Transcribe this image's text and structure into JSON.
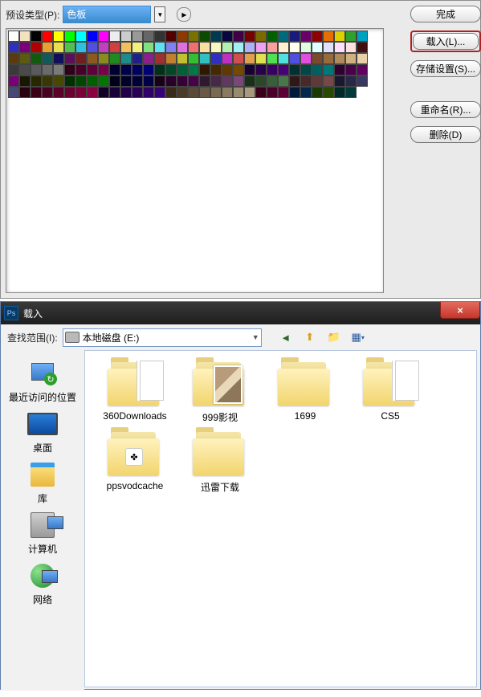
{
  "presetManager": {
    "typeLabel": "预设类型(P):",
    "typeValue": "色板",
    "buttons": {
      "done": "完成",
      "load": "载入(L)...",
      "save": "存储设置(S)...",
      "rename": "重命名(R)...",
      "delete": "删除(D)"
    },
    "swatches": [
      "#ffffff",
      "#f2e2c0",
      "#000000",
      "#ff0000",
      "#ffff00",
      "#00ff00",
      "#00ffff",
      "#0000ff",
      "#ff00ff",
      "#ededed",
      "#cccccc",
      "#999999",
      "#666666",
      "#333333",
      "#510000",
      "#8d3a00",
      "#7a7200",
      "#0c4a00",
      "#003a4e",
      "#08083e",
      "#3f0047",
      "#770000",
      "#7a6a00",
      "#006000",
      "#006a7a",
      "#1a1a7a",
      "#6a006a",
      "#8f0000",
      "#e96e00",
      "#dcd000",
      "#2fa02f",
      "#00a0c0",
      "#3030c0",
      "#7a007a",
      "#b00000",
      "#e8a030",
      "#e8e050",
      "#50c050",
      "#30c0e0",
      "#5050e0",
      "#c040c0",
      "#d04040",
      "#f0c060",
      "#f0f080",
      "#80e080",
      "#60e0f0",
      "#8080f0",
      "#e070e0",
      "#f07070",
      "#f8e0a0",
      "#f8f8c0",
      "#b0f0b0",
      "#a0f0f8",
      "#b0b0f8",
      "#f0a0f0",
      "#f8a0a0",
      "#fff0d0",
      "#fffff0",
      "#e0ffe0",
      "#e0ffff",
      "#e0e0ff",
      "#ffe0ff",
      "#ffe0e0",
      "#401010",
      "#5a3a10",
      "#5a5a10",
      "#105a10",
      "#105a5a",
      "#10105a",
      "#5a105a",
      "#702020",
      "#8a5a20",
      "#8a8a20",
      "#208a20",
      "#208a8a",
      "#20208a",
      "#8a208a",
      "#a03030",
      "#c08030",
      "#c0c030",
      "#30c030",
      "#30c0c0",
      "#3030c0",
      "#c030c0",
      "#d05050",
      "#e0a050",
      "#e0e050",
      "#50e050",
      "#50e0e0",
      "#5050e0",
      "#e050e0",
      "#7a4a2a",
      "#9a6a3a",
      "#b08a5a",
      "#d0b080",
      "#e8d0a8",
      "#3a3a3a",
      "#4a4a4a",
      "#5a5a5a",
      "#6a6a6a",
      "#7a7a7a",
      "#300018",
      "#480028",
      "#600038",
      "#780048",
      "#000030",
      "#000048",
      "#000060",
      "#000078",
      "#003018",
      "#004828",
      "#006038",
      "#007848",
      "#301800",
      "#482800",
      "#603800",
      "#784800",
      "#180030",
      "#280048",
      "#380060",
      "#480078",
      "#003030",
      "#004848",
      "#006060",
      "#007878",
      "#300030",
      "#480048",
      "#600060",
      "#780078",
      "#181800",
      "#282800",
      "#383800",
      "#484800",
      "#003000",
      "#004800",
      "#006000",
      "#007800",
      "#000018",
      "#000028",
      "#000038",
      "#000048",
      "#180018",
      "#280028",
      "#380038",
      "#480048",
      "#301830",
      "#482848",
      "#603860",
      "#784878",
      "#183018",
      "#284828",
      "#386038",
      "#487848",
      "#301818",
      "#482828",
      "#603838",
      "#784848",
      "#181830",
      "#282848",
      "#383860",
      "#484878",
      "#2a0010",
      "#3a0018",
      "#4a0020",
      "#5a0028",
      "#6a0030",
      "#7a0038",
      "#8a0040",
      "#100028",
      "#180038",
      "#200048",
      "#280058",
      "#300068",
      "#380078",
      "#3a2a1a",
      "#4a3a28",
      "#5a4a36",
      "#6a5a44",
      "#7a6a52",
      "#8a7a60",
      "#9a8a6e",
      "#a89a7c",
      "#3a001a",
      "#4a0028",
      "#5a0036",
      "#001a3a",
      "#00284a",
      "#1a3a00",
      "#284a00",
      "#002a2a",
      "#003a3a"
    ]
  },
  "dialog": {
    "title": "载入",
    "lookInLabel": "查找范围(I):",
    "lookInValue": "本地磁盘 (E:)",
    "places": {
      "recent": "最近访问的位置",
      "desktop": "桌面",
      "libraries": "库",
      "computer": "计算机",
      "network": "网络"
    },
    "items": [
      {
        "name": "360Downloads",
        "kind": "folder-papers"
      },
      {
        "name": "999影视",
        "kind": "folder-photo"
      },
      {
        "name": "1699",
        "kind": "folder"
      },
      {
        "name": "CS5",
        "kind": "folder-papers"
      },
      {
        "name": "ppsvodcache",
        "kind": "folder-app"
      },
      {
        "name": "迅雷下载",
        "kind": "folder"
      }
    ]
  }
}
